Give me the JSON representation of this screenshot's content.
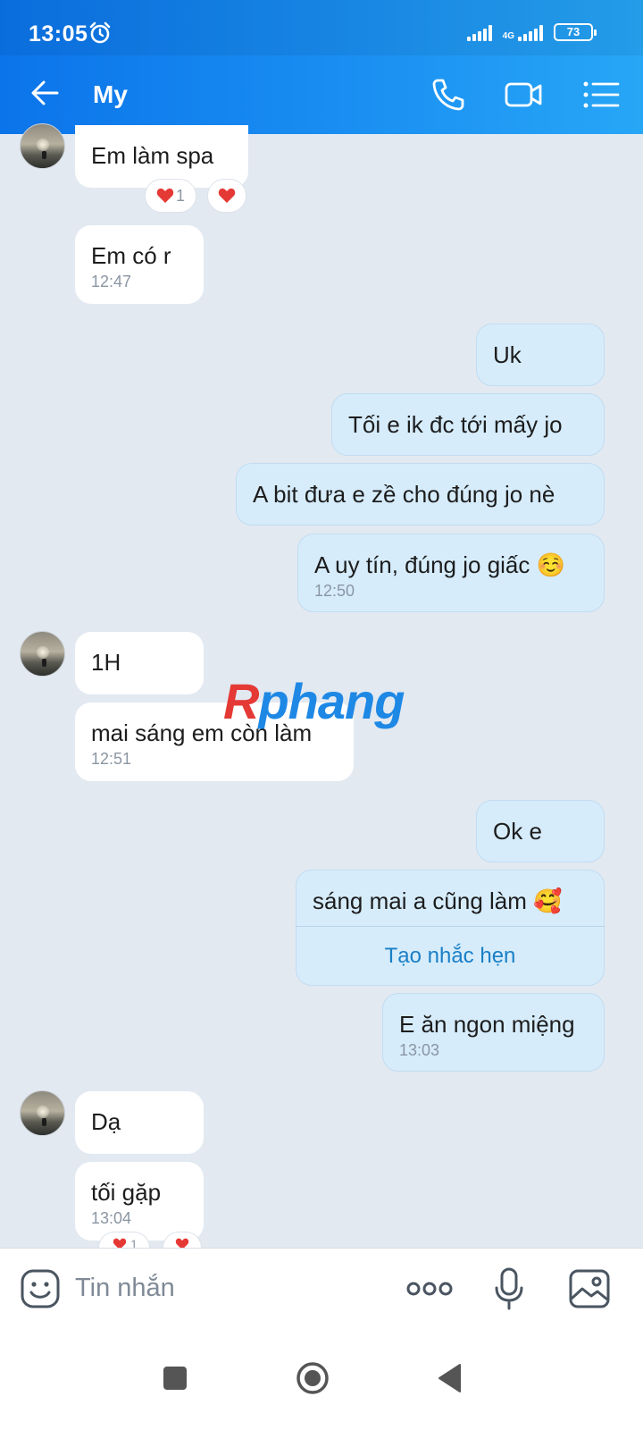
{
  "status_bar": {
    "time": "13:05",
    "network": "4G",
    "battery": "73"
  },
  "header": {
    "title": "My"
  },
  "messages": {
    "m1": {
      "text": "Em làm spa",
      "reaction_count": "1"
    },
    "m2": {
      "text": "Em có r",
      "time": "12:47"
    },
    "m3": {
      "text": "Uk"
    },
    "m4": {
      "text": "Tối e ik đc tới mấy jo"
    },
    "m5": {
      "text": "A bit đưa e zề cho đúng jo nè"
    },
    "m6": {
      "text": "A uy tín, đúng jo giấc ☺️",
      "time": "12:50"
    },
    "m7": {
      "text": "1H"
    },
    "m8": {
      "text": "mai sáng em còn làm",
      "time": "12:51"
    },
    "m9": {
      "text": "Ok e"
    },
    "m10": {
      "text": "sáng mai a cũng làm 🥰",
      "action": "Tạo nhắc hẹn"
    },
    "m11": {
      "text": "E ăn ngon miệng",
      "time": "13:03"
    },
    "m12": {
      "text": "Dạ"
    },
    "m13": {
      "text": "tối gặp",
      "time": "13:04",
      "reaction_count": "1"
    }
  },
  "watermark": {
    "part1": "R",
    "part2": "phang"
  },
  "composer": {
    "placeholder": "Tin nhắn"
  },
  "colors": {
    "header_start": "#0b74ea",
    "header_end": "#27a6f6",
    "outgoing_bubble": "#d6ecfb",
    "incoming_bubble": "#ffffff",
    "chat_background": "#e2e9f1",
    "reaction_heart": "#e53935",
    "reminder_link": "#1a7fc6"
  },
  "icons": [
    "alarm-icon",
    "signal-icon",
    "battery-icon",
    "back-arrow-icon",
    "phone-icon",
    "video-camera-icon",
    "list-menu-icon",
    "heart-icon",
    "emoji-icon",
    "more-icon",
    "microphone-icon",
    "image-icon",
    "recents-icon",
    "home-icon",
    "back-triangle-icon"
  ]
}
